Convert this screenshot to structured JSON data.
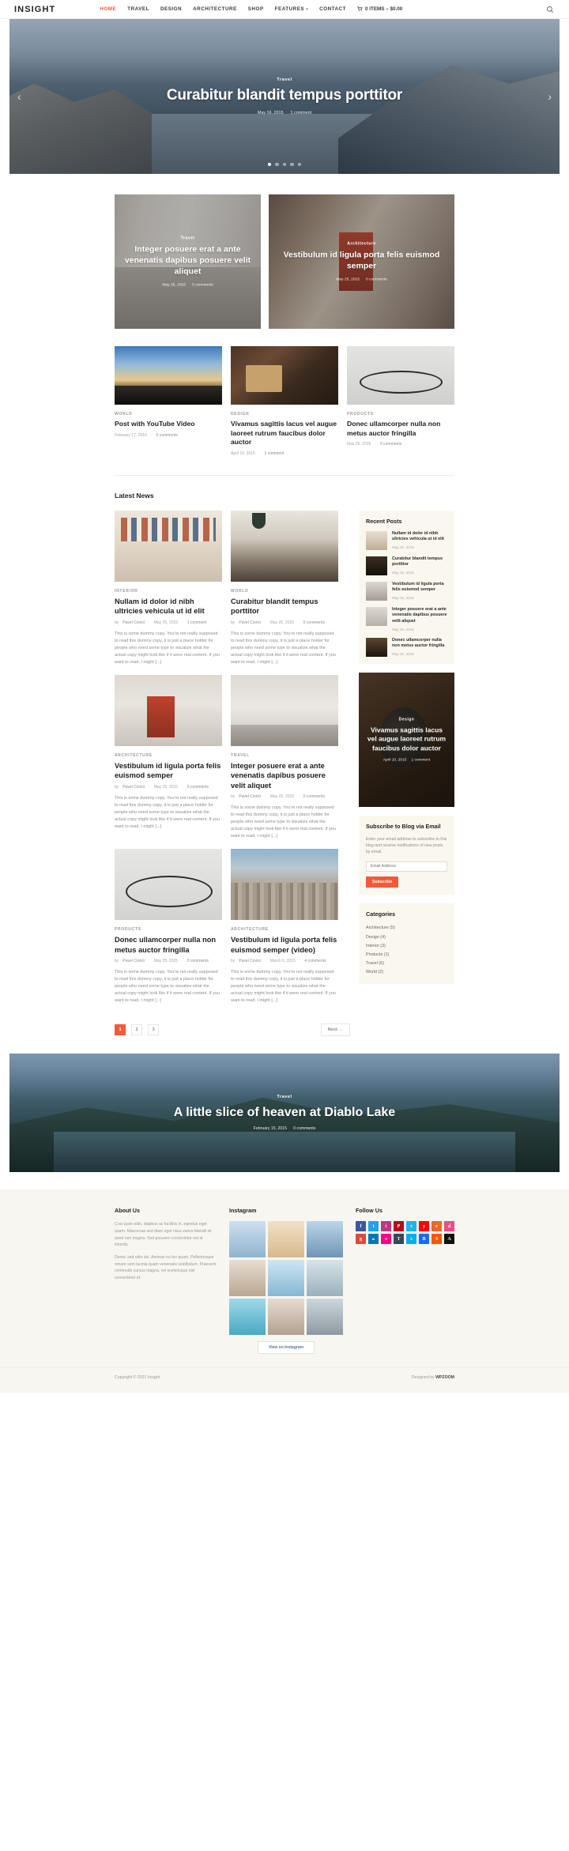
{
  "header": {
    "logo": "INSIGHT",
    "nav": [
      {
        "label": "HOME",
        "active": true
      },
      {
        "label": "TRAVEL",
        "active": false
      },
      {
        "label": "DESIGN",
        "active": false
      },
      {
        "label": "ARCHITECTURE",
        "active": false
      },
      {
        "label": "SHOP",
        "active": false
      },
      {
        "label": "FEATURES",
        "active": false,
        "has_dropdown": true
      },
      {
        "label": "CONTACT",
        "active": false
      }
    ],
    "cart_label": "0 ITEMS – $0.00",
    "search_icon": "search-icon"
  },
  "hero": {
    "category": "Travel",
    "title": "Curabitur blandit tempus porttitor",
    "date": "May 16, 2015",
    "comments": "1 comment",
    "prev_icon": "chevron-left-icon",
    "next_icon": "chevron-right-icon",
    "slide_count": 5,
    "active_slide": 1
  },
  "featured": [
    {
      "category": "Travel",
      "title": "Integer posuere erat a ante venenatis dapibus posuere velit aliquet",
      "date": "May 25, 2015",
      "comments": "0 comments"
    },
    {
      "category": "Architecture",
      "title": "Vestibulum id ligula porta felis euismod semper",
      "date": "May 25, 2015",
      "comments": "0 comments"
    }
  ],
  "grid3": [
    {
      "category": "WORLD",
      "title": "Post with YouTube Video",
      "date": "February 17, 2015",
      "comments": "0 comments"
    },
    {
      "category": "DESIGN",
      "title": "Vivamus sagittis lacus vel augue laoreet rutrum faucibus dolor auctor",
      "date": "April 10, 2015",
      "comments": "1 comment"
    },
    {
      "category": "PRODUCTS",
      "title": "Donec ullamcorper nulla non metus auctor fringilla",
      "date": "May 25, 2015",
      "comments": "0 comments"
    }
  ],
  "latest": {
    "section_title": "Latest News",
    "excerpt": "This is some dummy copy. You're not really supposed to read this dummy copy, it is just a place holder for people who need some type to visualize what the actual copy might look like if it were real content. If you want to read, I might [...]",
    "byline_prefix": "by",
    "posts": [
      {
        "category": "INTERIOR",
        "title": "Nullam id dolor id nibh ultricies vehicula ut id elit",
        "author": "Pavel Ciorici",
        "date": "May 25, 2015",
        "comments": "1 comment"
      },
      {
        "category": "WORLD",
        "title": "Curabitur blandit tempus porttitor",
        "author": "Pavel Ciorici",
        "date": "May 25, 2015",
        "comments": "0 comments"
      },
      {
        "category": "ARCHITECTURE",
        "title": "Vestibulum id ligula porta felis euismod semper",
        "author": "Pavel Ciorici",
        "date": "May 25, 2015",
        "comments": "0 comments"
      },
      {
        "category": "TRAVEL",
        "title": "Integer posuere erat a ante venenatis dapibus posuere velit aliquet",
        "author": "Pavel Ciorici",
        "date": "May 25, 2015",
        "comments": "0 comments"
      },
      {
        "category": "PRODUCTS",
        "title": "Donec ullamcorper nulla non metus auctor fringilla",
        "author": "Pavel Ciorici",
        "date": "May 25, 2015",
        "comments": "0 comments"
      },
      {
        "category": "ARCHITECTURE",
        "title": "Vestibulum id ligula porta felis euismod semper (video)",
        "author": "Pavel Ciorici",
        "date": "March 6, 2015",
        "comments": "4 comments"
      }
    ],
    "promo": {
      "category": "Design",
      "title": "Vivamus sagittis lacus vel augue laoreet rutrum faucibus dolor auctor",
      "date": "April 10, 2015",
      "comments": "1 comment"
    }
  },
  "sidebar": {
    "recent_posts": {
      "title": "Recent Posts",
      "items": [
        {
          "title": "Nullam id dolor id nibh ultricies vehicula ut id elit",
          "date": "May 25, 2015"
        },
        {
          "title": "Curabitur blandit tempus porttitor",
          "date": "May 25, 2015"
        },
        {
          "title": "Vestibulum id ligula porta felis euismod semper",
          "date": "May 25, 2015"
        },
        {
          "title": "Integer posuere erat a ante venenatis dapibus posuere velit aliquet",
          "date": "May 25, 2015"
        },
        {
          "title": "Donec ullamcorper nulla non metus auctor fringilla",
          "date": "May 25, 2015"
        }
      ]
    },
    "subscribe": {
      "title": "Subscribe to Blog via Email",
      "description": "Enter your email address to subscribe to this blog and receive notifications of new posts by email.",
      "input_placeholder": "Email Address",
      "input_value": "",
      "button_label": "Subscribe",
      "accent": "#f15a3a"
    },
    "categories": {
      "title": "Categories",
      "items": [
        "Architecture (5)",
        "Design (4)",
        "Interior (3)",
        "Products (1)",
        "Travel (6)",
        "World (2)"
      ]
    }
  },
  "pagination": {
    "pages": [
      "1",
      "2",
      "3"
    ],
    "active": "1",
    "next_label": "Next →"
  },
  "banner": {
    "category": "Travel",
    "title": "A little slice of heaven at Diablo Lake",
    "date": "February 15, 2015",
    "comments": "0 comments"
  },
  "footer": {
    "about": {
      "title": "About Us",
      "paragraph1": "Cras justo odio, dapibus ac facilisis in, egestas eget quam. Maecenas sed diam eget risus varius blandit sit amet non magna. Sed posuere consectetur est at lobortis.",
      "paragraph2": "Donec sed odio dui. Aenean eu leo quam. Pellentesque ornare sem lacinia quam venenatis vestibulum. Praesent commodo cursus magna, vel scelerisque nisl consectetur et."
    },
    "instagram": {
      "title": "Instagram",
      "button_label": "View on Instagram"
    },
    "follow": {
      "title": "Follow Us",
      "icons": [
        {
          "name": "facebook-icon",
          "glyph": "f",
          "color": "#3b5998"
        },
        {
          "name": "twitter-icon",
          "glyph": "t",
          "color": "#1da1f2"
        },
        {
          "name": "instagram-icon",
          "glyph": "i",
          "color": "#c13584"
        },
        {
          "name": "pinterest-icon",
          "glyph": "P",
          "color": "#bd081c"
        },
        {
          "name": "vimeo-icon",
          "glyph": "v",
          "color": "#1ab7ea"
        },
        {
          "name": "youtube-icon",
          "glyph": "y",
          "color": "#ff0000"
        },
        {
          "name": "rss-icon",
          "glyph": "r",
          "color": "#f26522"
        },
        {
          "name": "dribbble-icon",
          "glyph": "d",
          "color": "#ea4c89"
        },
        {
          "name": "google-plus-icon",
          "glyph": "g",
          "color": "#dd4b39"
        },
        {
          "name": "linkedin-icon",
          "glyph": "in",
          "color": "#0077b5"
        },
        {
          "name": "flickr-icon",
          "glyph": "fl",
          "color": "#ff0084"
        },
        {
          "name": "tumblr-icon",
          "glyph": "T",
          "color": "#35465c"
        },
        {
          "name": "skype-icon",
          "glyph": "s",
          "color": "#00aff0"
        },
        {
          "name": "behance-icon",
          "glyph": "B",
          "color": "#1769ff"
        },
        {
          "name": "soundcloud-icon",
          "glyph": "S",
          "color": "#ff5500"
        },
        {
          "name": "apple-icon",
          "glyph": "A",
          "color": "#111111"
        }
      ]
    },
    "copyright": "Copyright © 2021 Insight",
    "designed_prefix": "Designed by",
    "designed_by": "WPZOOM"
  }
}
